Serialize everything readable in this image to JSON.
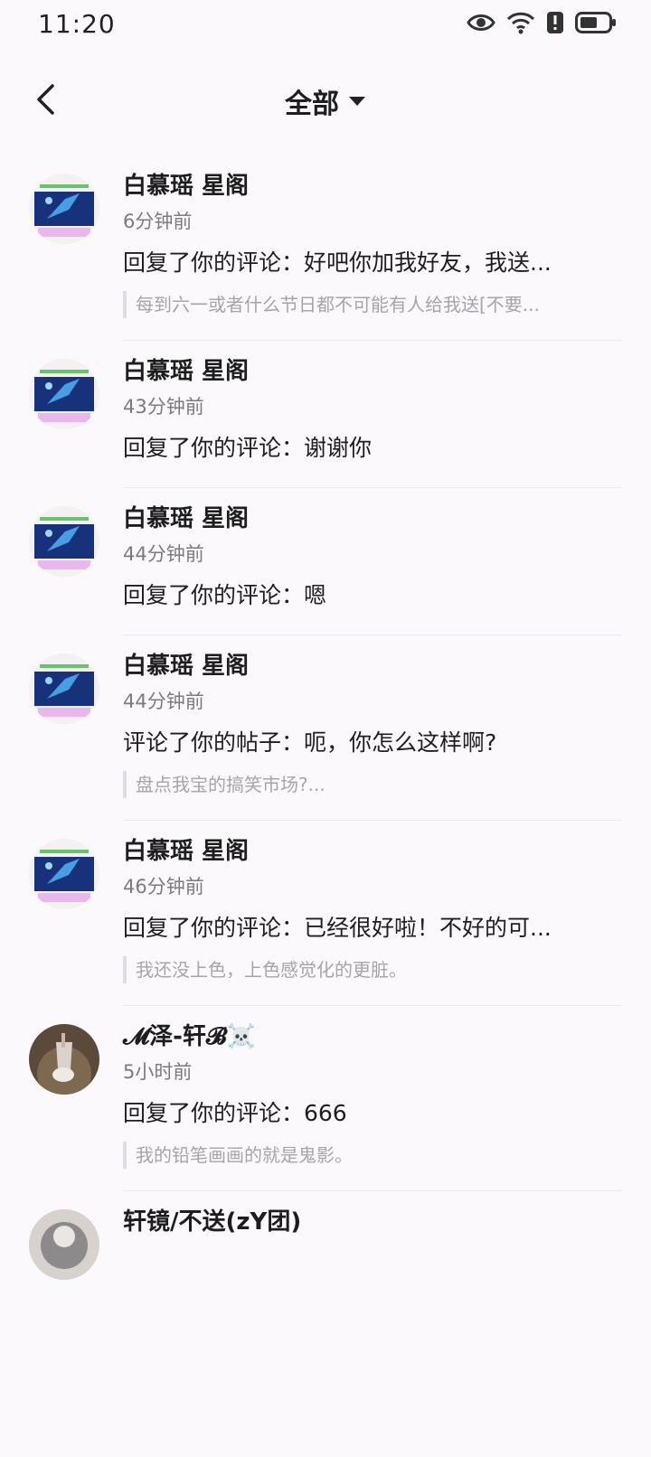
{
  "status_bar": {
    "time": "11:20",
    "icons": [
      "eye-icon",
      "wifi-icon",
      "alert-icon",
      "battery-icon"
    ]
  },
  "header": {
    "back_icon": "chevron-left-icon",
    "filter_label": "全部",
    "filter_icon": "caret-down-icon"
  },
  "notifications": [
    {
      "avatar": "galaxy-avatar",
      "name": "白慕瑶 星阁",
      "time": "6分钟前",
      "message": "回复了你的评论：好吧你加我好友，我送...",
      "quote": "每到六一或者什么节日都不可能有人给我送[不要..."
    },
    {
      "avatar": "galaxy-avatar",
      "name": "白慕瑶 星阁",
      "time": "43分钟前",
      "message": "回复了你的评论：谢谢你",
      "quote": ""
    },
    {
      "avatar": "galaxy-avatar",
      "name": "白慕瑶 星阁",
      "time": "44分钟前",
      "message": "回复了你的评论：嗯",
      "quote": ""
    },
    {
      "avatar": "galaxy-avatar",
      "name": "白慕瑶 星阁",
      "time": "44分钟前",
      "message": "评论了你的帖子：呃，你怎么这样啊?",
      "quote": "盘点我宝的搞笑市场?..."
    },
    {
      "avatar": "galaxy-avatar",
      "name": "白慕瑶 星阁",
      "time": "46分钟前",
      "message": "回复了你的评论：已经很好啦！不好的可...",
      "quote": "我还没上色，上色感觉化的更脏。"
    },
    {
      "avatar": "photo-avatar",
      "name": "𝓜泽-轩𝓑☠️",
      "time": "5小时前",
      "message": "回复了你的评论：666",
      "quote": "我的铅笔画画的就是鬼影。"
    },
    {
      "avatar": "photo-avatar",
      "name": "轩镜/不送(zY团)",
      "time": "",
      "message": "",
      "quote": ""
    }
  ]
}
